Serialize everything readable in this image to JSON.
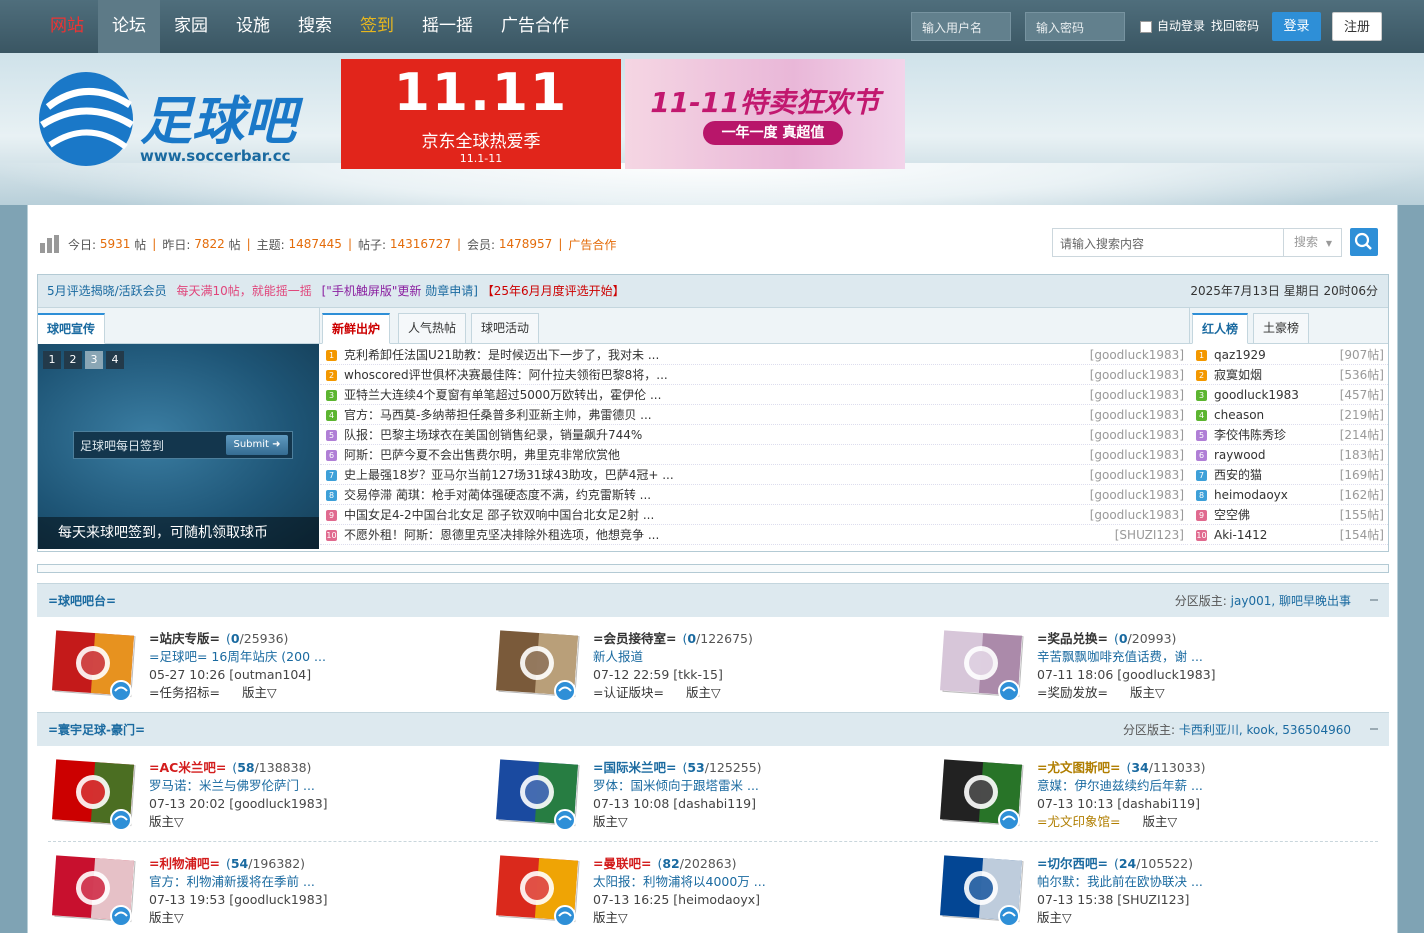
{
  "nav": {
    "items": [
      "网站",
      "论坛",
      "家园",
      "设施",
      "搜索",
      "签到",
      "摇一摇",
      "广告合作"
    ]
  },
  "login": {
    "username_placeholder": "输入用户名",
    "password_placeholder": "输入密码",
    "auto_login": "自动登录",
    "find_password": "找回密码",
    "login_button": "登录",
    "register_button": "注册"
  },
  "logo": {
    "name": "足球吧",
    "url": "www.soccerbar.cc"
  },
  "ads": [
    {
      "title": "11.11",
      "line1": "京东全球热爱季",
      "line2": "11.1-11"
    },
    {
      "title": "11-11特卖狂欢节",
      "line1": "一年一度 真超值"
    }
  ],
  "stats": {
    "today_label": "今日:",
    "today": "5931",
    "post_unit": "帖",
    "yesterday_label": "昨日:",
    "yesterday": "7822",
    "topics_label": "主题:",
    "topics": "1487445",
    "posts_label": "帖子:",
    "posts": "14316727",
    "members_label": "会员:",
    "members": "1478957",
    "ad_link": "广告合作"
  },
  "search": {
    "placeholder": "请输入搜索内容",
    "type": "搜索"
  },
  "notice": {
    "items": [
      {
        "text": "5月评选揭晓/活跃会员",
        "color": "#1a6aa0"
      },
      {
        "text": "每天满10帖，就能摇一摇",
        "color": "#e0457b"
      },
      {
        "text": "[\"手机触屏版\"更新",
        "color": "#8a1fa0"
      },
      {
        "text": "勋章申请]",
        "color": "#1a6aa0"
      },
      {
        "text": "【25年6月月度评选开始】",
        "color": "#c00"
      }
    ],
    "date": "2025年7月13日 星期日 20时06分"
  },
  "tabs": {
    "promo": "球吧宣传",
    "center": [
      "新鲜出炉",
      "人气热帖",
      "球吧活动"
    ],
    "right": [
      "红人榜",
      "土豪榜"
    ]
  },
  "slide": {
    "pages": [
      "1",
      "2",
      "3",
      "4"
    ],
    "input_text": "足球吧每日签到",
    "submit": "Submit",
    "caption": "每天来球吧签到，可随机领取球币"
  },
  "threads": [
    {
      "no": "1",
      "title": "克利希卸任法国U21助教：是时候迈出下一步了，我对未 ...",
      "author": "[goodluck1983]"
    },
    {
      "no": "2",
      "title": "whoscored评世俱杯决赛最佳阵：阿什拉夫领衔巴黎8将，...",
      "author": "[goodluck1983]"
    },
    {
      "no": "3",
      "title": "亚特兰大连续4个夏窗有单笔超过5000万欧转出，霍伊伦 ...",
      "author": "[goodluck1983]"
    },
    {
      "no": "4",
      "title": "官方：马西莫-多纳蒂担任桑普多利亚新主帅，弗雷德贝 ...",
      "author": "[goodluck1983]"
    },
    {
      "no": "5",
      "title": "队报：巴黎主场球衣在美国创销售纪录，销量飙升744%",
      "author": "[goodluck1983]"
    },
    {
      "no": "6",
      "title": "阿斯：巴萨今夏不会出售费尔明，弗里克非常欣赏他",
      "author": "[goodluck1983]"
    },
    {
      "no": "7",
      "title": "史上最强18岁？亚马尔当前127场31球43助攻，巴萨4冠+ ...",
      "author": "[goodluck1983]"
    },
    {
      "no": "8",
      "title": "交易停滞 蔺琪：枪手对蔺体强硬态度不满，约克雷斯转 ...",
      "author": "[goodluck1983]"
    },
    {
      "no": "9",
      "title": "中国女足4-2中国台北女足 邵子钦双响中国台北女足2射 ...",
      "author": "[goodluck1983]"
    },
    {
      "no": "10",
      "title": "不愿外租！阿斯：恩德里克坚决排除外租选项，他想竞争 ...",
      "author": "[SHUZI123]"
    }
  ],
  "ranking": [
    {
      "no": "1",
      "name": "qaz1929",
      "count": "[907帖]"
    },
    {
      "no": "2",
      "name": "寂寞如烟",
      "count": "[536帖]"
    },
    {
      "no": "3",
      "name": "goodluck1983",
      "count": "[457帖]"
    },
    {
      "no": "4",
      "name": "cheason",
      "count": "[219帖]"
    },
    {
      "no": "5",
      "name": "李佼伟陈秀珍",
      "count": "[214帖]"
    },
    {
      "no": "6",
      "name": "raywood",
      "count": "[183帖]"
    },
    {
      "no": "7",
      "name": "西安的猫",
      "count": "[169帖]"
    },
    {
      "no": "8",
      "name": "heimodaoyx",
      "count": "[162帖]"
    },
    {
      "no": "9",
      "name": "空空佛",
      "count": "[155帖]"
    },
    {
      "no": "10",
      "name": "Aki-1412",
      "count": "[154帖]"
    }
  ],
  "icon_colors": [
    "#f39800",
    "#f39800",
    "#5cb531",
    "#5cb531",
    "#b07fd6",
    "#b07fd6",
    "#3ea0d8",
    "#3ea0d8",
    "#e06a8f",
    "#e06a8f"
  ],
  "sections": [
    {
      "title": "=球吧吧台=",
      "mods_label": "分区版主:",
      "mods": "jay001, 聊吧早晚出事",
      "forums": [
        {
          "name": "=站庆专版=",
          "color": "dark",
          "today": "0",
          "total": "/25936)",
          "last": "=足球吧= 16周年站庆 (200 ...",
          "time": "05-27 10:26 [outman104]",
          "extra": "=任务招标=",
          "mod": "版主▽"
        },
        {
          "name": "=会员接待室=",
          "color": "dark",
          "today": "0",
          "total": "/122675)",
          "last": "新人报道",
          "time": "07-12 22:59 [tkk-15]",
          "extra": "=认证版块=",
          "mod": "版主▽"
        },
        {
          "name": "=奖品兑换=",
          "color": "dark",
          "today": "0",
          "total": "/20993)",
          "last": "辛苦飘飘咖啡充值话费，谢 ...",
          "time": "07-11 18:06 [goodluck1983]",
          "extra": "=奖励发放=",
          "mod": "版主▽"
        }
      ]
    },
    {
      "title": "=寰宇足球-豪门=",
      "mods_label": "分区版主:",
      "mods": "卡西利亚川, kook, 536504960",
      "forums": [
        {
          "name": "=AC米兰吧=",
          "color": "red",
          "today": "58",
          "total": "/138838)",
          "last": "罗马诺：米兰与佛罗伦萨门 ...",
          "time": "07-13 20:02 [goodluck1983]",
          "extra": "",
          "mod": "版主▽"
        },
        {
          "name": "=国际米兰吧=",
          "color": "blue",
          "today": "53",
          "total": "/125255)",
          "last": "罗体：国米倾向于跟塔雷米 ...",
          "time": "07-13 10:08 [dashabi119]",
          "extra": "",
          "mod": "版主▽"
        },
        {
          "name": "=尤文图斯吧=",
          "color": "gold",
          "today": "34",
          "total": "/113033)",
          "last": "意媒：伊尔迪兹续约后年薪 ...",
          "time": "07-13 10:13 [dashabi119]",
          "extra": "=尤文印象馆=",
          "mod": "版主▽"
        },
        {
          "name": "=利物浦吧=",
          "color": "red",
          "today": "54",
          "total": "/196382)",
          "last": "官方：利物浦新援将在季前 ...",
          "time": "07-13 19:53 [goodluck1983]",
          "extra": "",
          "mod": "版主▽"
        },
        {
          "name": "=曼联吧=",
          "color": "red",
          "today": "82",
          "total": "/202863)",
          "last": "太阳报：利物浦将以4000万 ...",
          "time": "07-13 16:25 [heimodaoyx]",
          "extra": "",
          "mod": "版主▽"
        },
        {
          "name": "=切尔西吧=",
          "color": "blue",
          "today": "24",
          "total": "/105522)",
          "last": "帕尔默：我此前在欧协联决 ...",
          "time": "07-13 15:38 [SHUZI123]",
          "extra": "",
          "mod": "版主▽"
        }
      ]
    }
  ]
}
